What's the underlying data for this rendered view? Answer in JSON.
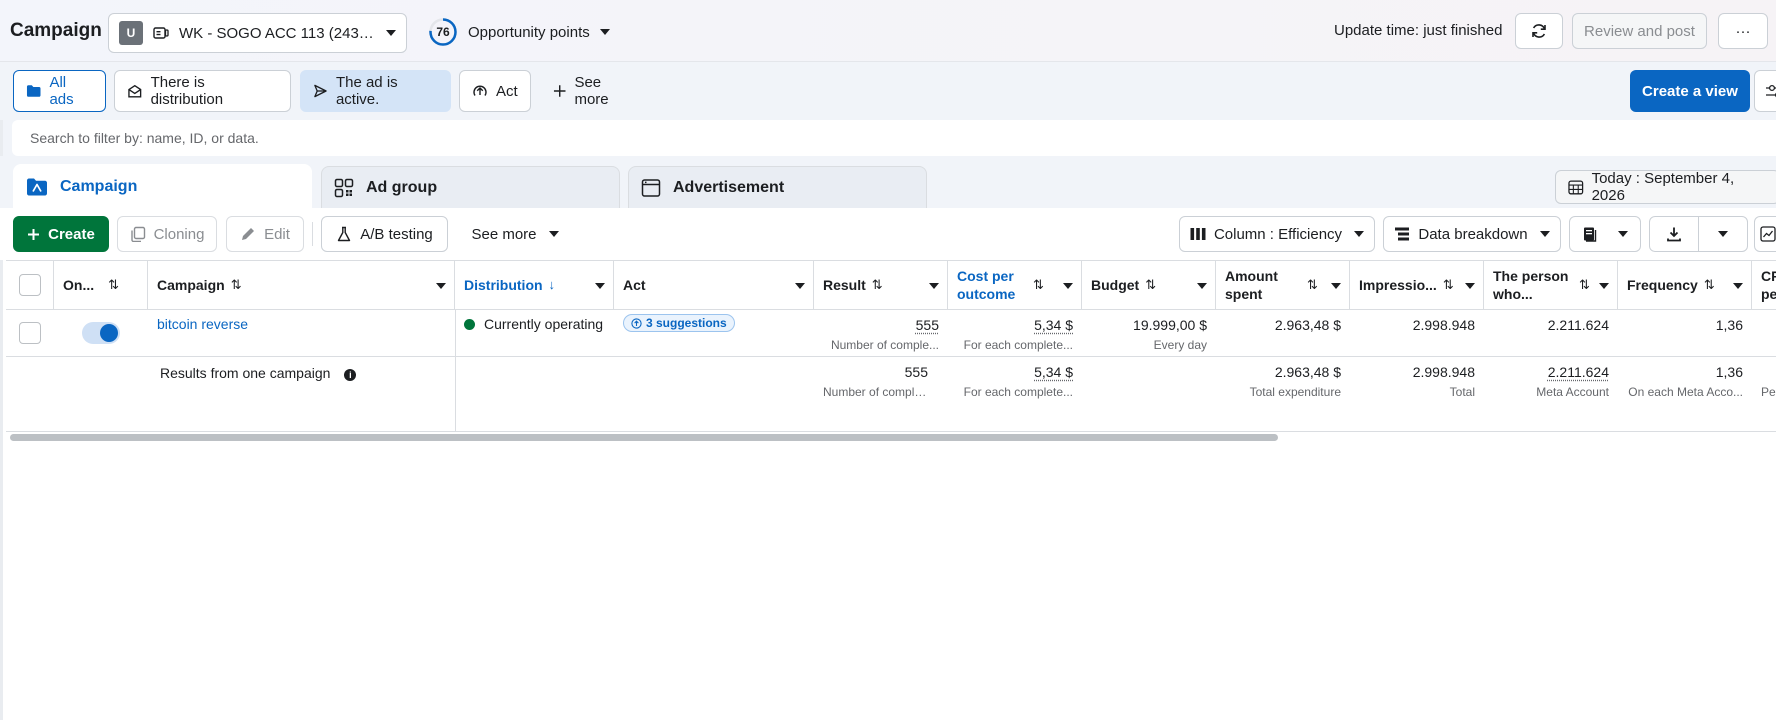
{
  "header": {
    "title": "Campaign",
    "account_badge": "U",
    "account_name": "WK - SOGO ACC 113 (243…",
    "opportunity_score": "76",
    "opportunity_label": "Opportunity points",
    "update_time": "Update time: just finished",
    "review_label": "Review and post",
    "more_label": "···"
  },
  "filters": {
    "chips": [
      {
        "label": "All ads"
      },
      {
        "label": "There is distribution"
      },
      {
        "label": "The ad is active."
      },
      {
        "label": "Act"
      },
      {
        "label": "See more"
      }
    ],
    "create_view": "Create a view"
  },
  "search": {
    "placeholder": "Search to filter by: name, ID, or data."
  },
  "levels": {
    "tabs": [
      {
        "label": "Campaign"
      },
      {
        "label": "Ad group"
      },
      {
        "label": "Advertisement"
      }
    ],
    "date": "Today : September 4, 2026"
  },
  "toolbar": {
    "create": "Create",
    "cloning": "Cloning",
    "edit": "Edit",
    "ab_testing": "A/B testing",
    "see_more": "See more",
    "column": "Column : Efficiency",
    "breakdown": "Data breakdown"
  },
  "table": {
    "headers": {
      "on": "On...",
      "campaign": "Campaign",
      "distribution": "Distribution",
      "act": "Act",
      "result": "Result",
      "cost_per_outcome": "Cost per outcome",
      "budget": "Budget",
      "amount_spent": "Amount spent",
      "impressions": "Impressio...",
      "person_who": "The person who...",
      "frequency": "Frequency",
      "cpm": "CP per"
    },
    "row": {
      "campaign": "bitcoin reverse",
      "distribution": "Currently operating",
      "suggestions": "3 suggestions",
      "result": "555",
      "result_sub": "Number of comple...",
      "cost": "5,34 $",
      "cost_sub": "For each complete...",
      "budget": "19.999,00 $",
      "budget_sub": "Every day",
      "amount_spent": "2.963,48 $",
      "impressions": "2.998.948",
      "person_who": "2.211.624",
      "frequency": "1,36"
    },
    "summary": {
      "label": "Results from one campaign",
      "result": "555",
      "result_sub": "Number of comple...",
      "cost": "5,34 $",
      "cost_sub": "For each complete...",
      "amount_spent": "2.963,48 $",
      "amount_spent_sub": "Total expenditure",
      "impressions": "2.998.948",
      "impressions_sub": "Total",
      "person_who": "2.211.624",
      "person_who_sub": "Meta Account",
      "frequency": "1,36",
      "frequency_sub": "On each Meta Acco...",
      "cpm_sub": "Per"
    }
  },
  "colors": {
    "accent": "#0a66c2",
    "create_green": "#00753b",
    "status_green": "#00753b"
  }
}
